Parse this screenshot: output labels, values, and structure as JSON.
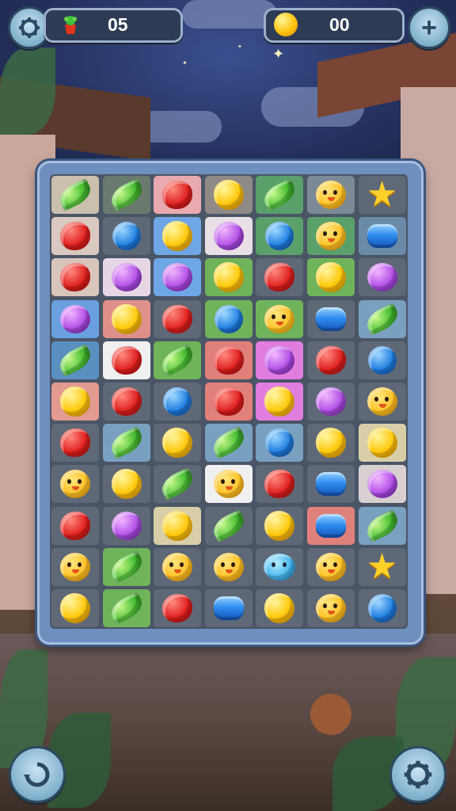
{
  "hud": {
    "moves_value": "05",
    "coins_value": "00",
    "icons": {
      "settings": "gear-icon",
      "moves": "potted-plant-icon",
      "coins": "coin-icon",
      "add": "plus-icon",
      "refresh": "refresh-icon",
      "bottom_settings": "gear-icon"
    }
  },
  "board": {
    "rows": 11,
    "cols": 7,
    "grid": [
      [
        "green",
        "green",
        "red",
        "yellow",
        "green",
        "chick",
        "star"
      ],
      [
        "red",
        "blue",
        "yellow",
        "purple",
        "blue",
        "chick",
        "pillblue"
      ],
      [
        "red",
        "purple",
        "purple",
        "yellow",
        "red",
        "yellow",
        "purple"
      ],
      [
        "purple",
        "yellow",
        "red",
        "blue",
        "chick",
        "pillblue",
        "green"
      ],
      [
        "green",
        "red",
        "green",
        "red",
        "purple",
        "red",
        "blue"
      ],
      [
        "yellow",
        "red",
        "blue",
        "red",
        "yellow",
        "purple",
        "chick"
      ],
      [
        "red",
        "green",
        "yellow",
        "green",
        "blue",
        "yellow",
        "yellow"
      ],
      [
        "chick",
        "yellow",
        "green",
        "chick",
        "red",
        "pillblue",
        "purple"
      ],
      [
        "red",
        "purple",
        "yellow",
        "green",
        "yellow",
        "pillblue",
        "green"
      ],
      [
        "chick",
        "green",
        "chick",
        "chick",
        "bluechick",
        "chick",
        "star"
      ],
      [
        "yellow",
        "green",
        "red",
        "pillblue",
        "yellow",
        "chick",
        "blue"
      ]
    ],
    "cell_tints": [
      [
        "#cbbfae",
        "#6a7a6e",
        "#e8aab0",
        "#8f8a86",
        "#5aa06a",
        "#7c8a96",
        "#5f6876"
      ],
      [
        "#d9c9c0",
        "#5f6876",
        "#6ea6e6",
        "#e8e0e6",
        "#5aa06a",
        "#5aa06a",
        "#6a8aa8"
      ],
      [
        "#d8c5bb",
        "#e6d6e4",
        "#6ea6e6",
        "#6fb35a",
        "#5f6876",
        "#6fb35a",
        "#5f6876"
      ],
      [
        "#6aa0e0",
        "#e0908a",
        "#5f6876",
        "#6fb35a",
        "#6fb35a",
        "#5f6876",
        "#7aa0c0"
      ],
      [
        "#5a90c0",
        "#f0f0f0",
        "#6fb35a",
        "#e0807a",
        "#e27de0",
        "#5f6876",
        "#5f6876"
      ],
      [
        "#e39a90",
        "#5f6876",
        "#5f6876",
        "#e0807a",
        "#e27de0",
        "#5f6876",
        "#5f6876"
      ],
      [
        "#5f6876",
        "#7aa0c0",
        "#5f6876",
        "#7aa0c0",
        "#7aa0c0",
        "#5f6876",
        "#d8cfa8"
      ],
      [
        "#5f6876",
        "#5f6876",
        "#5f6876",
        "#f0f0f0",
        "#5f6876",
        "#5f6876",
        "#d8d0d0"
      ],
      [
        "#5f6876",
        "#5f6876",
        "#d8cfa8",
        "#5f6876",
        "#5f6876",
        "#e0807a",
        "#7aa0c0"
      ],
      [
        "#5f6876",
        "#6fb35a",
        "#5f6876",
        "#5f6876",
        "#5f6876",
        "#5f6876",
        "#5f6876"
      ],
      [
        "#5f6876",
        "#6fb35a",
        "#5f6876",
        "#5f6876",
        "#5f6876",
        "#5f6876",
        "#5f6876"
      ]
    ]
  }
}
